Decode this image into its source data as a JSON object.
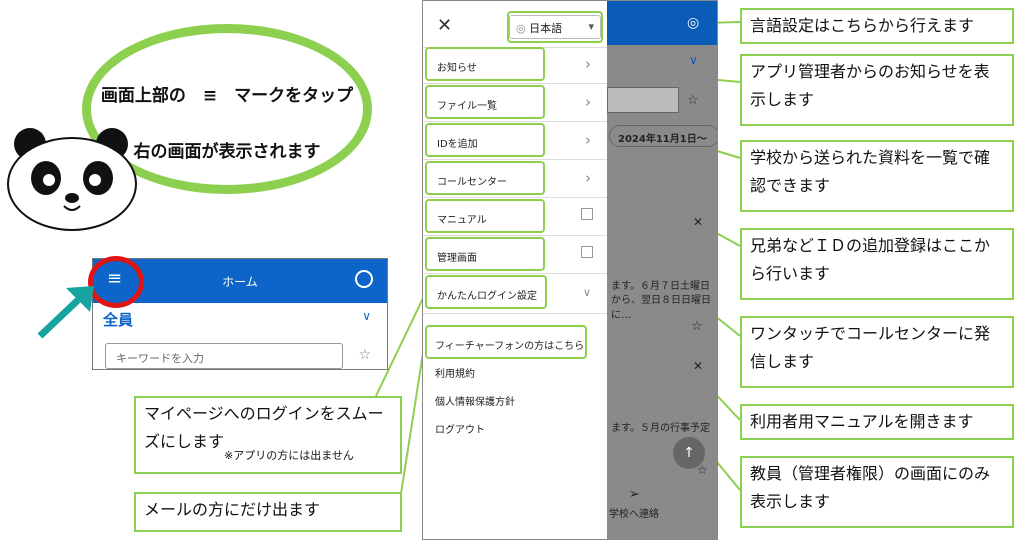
{
  "bubble": {
    "line1": "画面上部の　≡　マークをタップ",
    "line2": "右の画面が表示されます"
  },
  "mini": {
    "title": "ホーム",
    "hamburger": "≡",
    "all_label": "全員",
    "search_placeholder": "キーワードを入力",
    "star": "☆",
    "chevron": "∨"
  },
  "drawer": {
    "close": "✕",
    "language": "日本語",
    "globe": "◎",
    "caret": "▾",
    "items": [
      {
        "label": "お知らせ",
        "icon": "chevron-right"
      },
      {
        "label": "ファイル一覧",
        "icon": "chevron-right"
      },
      {
        "label": "IDを追加",
        "icon": "chevron-right"
      },
      {
        "label": "コールセンター",
        "icon": "chevron-right"
      },
      {
        "label": "マニュアル",
        "icon": "external-link"
      },
      {
        "label": "管理画面",
        "icon": "external-link"
      },
      {
        "label": "かんたんログイン設定",
        "icon": "chevron-down"
      }
    ],
    "feature_phone": "フィーチャーフォンの方はこちら",
    "terms": "利用規約",
    "privacy": "個人情報保護方針",
    "logout": "ログアウト"
  },
  "background": {
    "date_chip": "2024年11月1日～",
    "snippet1": "ます。６月７日土曜日",
    "snippet2": "から、翌日８日日曜日に…",
    "snippet3": "ます。５月の行事予定",
    "school_contact": "学校へ連絡"
  },
  "callouts": {
    "language": "言語設定はこちらから行えます",
    "notice": "アプリ管理者からのお知らせを表示します",
    "files": "学校から送られた資料を一覧で確認できます",
    "add_id": "兄弟などＩＤの追加登録はここから行います",
    "call_center": "ワンタッチでコールセンターに発信します",
    "manual": "利用者用マニュアルを開きます",
    "admin": "教員（管理者権限）の画面にのみ表示します",
    "easy_login": "マイページへのログインをスムーズにします",
    "easy_login_note": "※アプリの方には出ません",
    "feature_phone": "メールの方にだけ出ます"
  },
  "colors": {
    "accent_green": "#8dcf4f",
    "header_blue": "#0e65c9",
    "circle_red": "#e11414",
    "arrow_teal": "#17a3a0"
  }
}
